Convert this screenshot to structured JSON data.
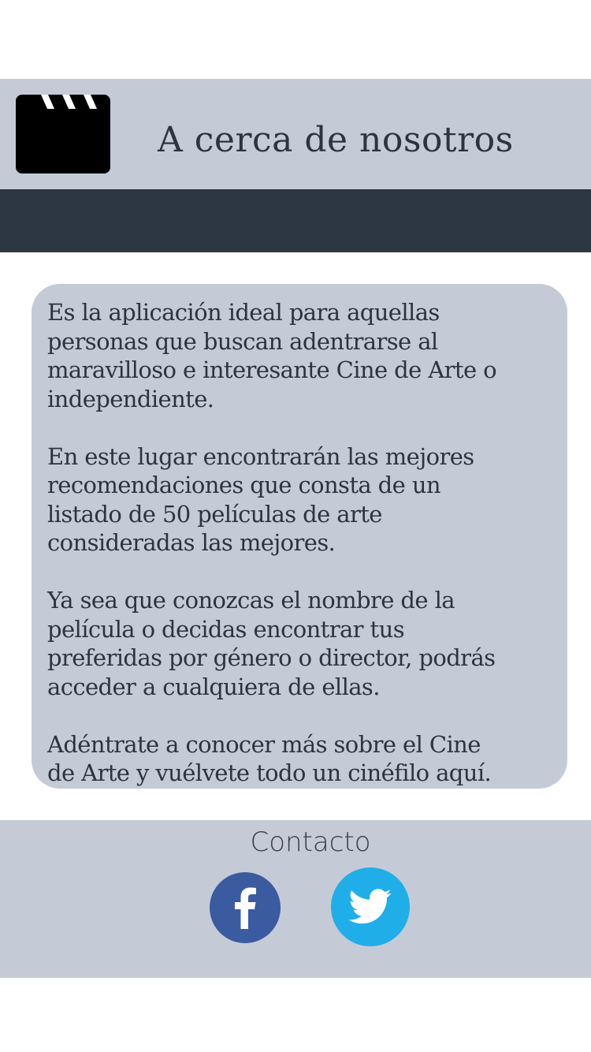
{
  "header": {
    "title": "A cerca de nosotros",
    "logo_icon": "film-clapperboard-icon"
  },
  "content": {
    "paragraphs": [
      "Es la aplicación ideal para aquellas\npersonas que buscan adentrarse al\nmaravilloso e interesante Cine de Arte o\nindependiente.",
      "En este lugar encontrarán las mejores\nrecomendaciones que consta de un\nlistado de 50 películas de arte\nconsideradas las mejores.",
      "Ya sea que conozcas el nombre de la\npelícula o decidas encontrar tus\npreferidas por género o director, podrás\nacceder a cualquiera de ellas.",
      "Adéntrate a conocer más sobre el Cine\nde Arte y vuélvete todo un cinéfilo  aquí."
    ]
  },
  "footer": {
    "contact_label": "Contacto",
    "social": [
      {
        "name": "facebook-icon",
        "color": "#3b5ba1"
      },
      {
        "name": "twitter-icon",
        "color": "#1faee8"
      }
    ]
  },
  "colors": {
    "panel": "#c4cbd6",
    "dark_bar": "#2d3643",
    "text": "#2c3440"
  }
}
